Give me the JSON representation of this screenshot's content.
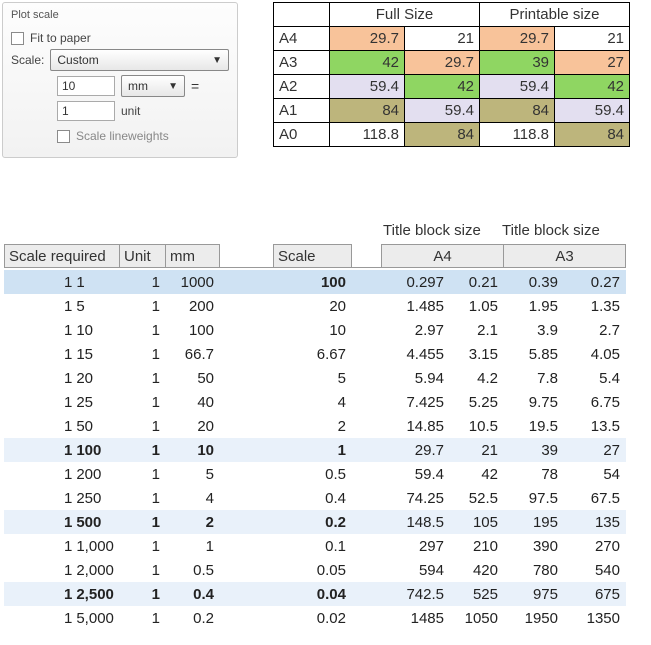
{
  "plot_scale": {
    "panel_title": "Plot scale",
    "fit_label": "Fit to paper",
    "scale_label": "Scale:",
    "scale_dropdown": "Custom",
    "value_a": "10",
    "unit_dropdown": "mm",
    "value_b": "1",
    "unit_text": "unit",
    "lineweights_label": "Scale lineweights"
  },
  "size_table": {
    "header_full": "Full Size",
    "header_print": "Printable size",
    "rows": [
      {
        "label": "A4",
        "full_a": "29.7",
        "full_b": "21",
        "print_a": "29.7",
        "print_b": "21",
        "cls_a": "c-orange",
        "cls_b": "c-white",
        "cls_c": "c-orange",
        "cls_d": "c-white"
      },
      {
        "label": "A3",
        "full_a": "42",
        "full_b": "29.7",
        "print_a": "39",
        "print_b": "27",
        "cls_a": "c-green",
        "cls_b": "c-orange",
        "cls_c": "c-green",
        "cls_d": "c-orange"
      },
      {
        "label": "A2",
        "full_a": "59.4",
        "full_b": "42",
        "print_a": "59.4",
        "print_b": "42",
        "cls_a": "c-lav",
        "cls_b": "c-green",
        "cls_c": "c-lav",
        "cls_d": "c-green"
      },
      {
        "label": "A1",
        "full_a": "84",
        "full_b": "59.4",
        "print_a": "84",
        "print_b": "59.4",
        "cls_a": "c-olive",
        "cls_b": "c-lav",
        "cls_c": "c-olive",
        "cls_d": "c-lav"
      },
      {
        "label": "A0",
        "full_a": "118.8",
        "full_b": "84",
        "print_a": "118.8",
        "print_b": "84",
        "cls_a": "c-white",
        "cls_b": "c-olive",
        "cls_c": "c-white",
        "cls_d": "c-olive"
      }
    ]
  },
  "scale_table": {
    "title_block_label": "Title block size",
    "headers": {
      "scale_required": "Scale required",
      "unit": "Unit",
      "mm": "mm",
      "scale": "Scale",
      "a4": "A4",
      "a3": "A3"
    },
    "rows": [
      {
        "hl": "blue",
        "bold": false,
        "sr": "1",
        "ratio": "1",
        "unit": "1",
        "mm": "1000",
        "scale": "100",
        "a4a": "0.297",
        "a4b": "0.21",
        "a3a": "0.39",
        "a3b": "0.27",
        "scale_bold": true
      },
      {
        "hl": "",
        "bold": false,
        "sr": "1",
        "ratio": "5",
        "unit": "1",
        "mm": "200",
        "scale": "20",
        "a4a": "1.485",
        "a4b": "1.05",
        "a3a": "1.95",
        "a3b": "1.35"
      },
      {
        "hl": "",
        "bold": false,
        "sr": "1",
        "ratio": "10",
        "unit": "1",
        "mm": "100",
        "scale": "10",
        "a4a": "2.97",
        "a4b": "2.1",
        "a3a": "3.9",
        "a3b": "2.7"
      },
      {
        "hl": "",
        "bold": false,
        "sr": "1",
        "ratio": "15",
        "unit": "1",
        "mm": "66.7",
        "scale": "6.67",
        "a4a": "4.455",
        "a4b": "3.15",
        "a3a": "5.85",
        "a3b": "4.05"
      },
      {
        "hl": "",
        "bold": false,
        "sr": "1",
        "ratio": "20",
        "unit": "1",
        "mm": "50",
        "scale": "5",
        "a4a": "5.94",
        "a4b": "4.2",
        "a3a": "7.8",
        "a3b": "5.4"
      },
      {
        "hl": "",
        "bold": false,
        "sr": "1",
        "ratio": "25",
        "unit": "1",
        "mm": "40",
        "scale": "4",
        "a4a": "7.425",
        "a4b": "5.25",
        "a3a": "9.75",
        "a3b": "6.75"
      },
      {
        "hl": "",
        "bold": false,
        "sr": "1",
        "ratio": "50",
        "unit": "1",
        "mm": "20",
        "scale": "2",
        "a4a": "14.85",
        "a4b": "10.5",
        "a3a": "19.5",
        "a3b": "13.5"
      },
      {
        "hl": "light",
        "bold": true,
        "sr": "1",
        "ratio": "100",
        "unit": "1",
        "mm": "10",
        "scale": "1",
        "a4a": "29.7",
        "a4b": "21",
        "a3a": "39",
        "a3b": "27"
      },
      {
        "hl": "",
        "bold": false,
        "sr": "1",
        "ratio": "200",
        "unit": "1",
        "mm": "5",
        "scale": "0.5",
        "a4a": "59.4",
        "a4b": "42",
        "a3a": "78",
        "a3b": "54"
      },
      {
        "hl": "",
        "bold": false,
        "sr": "1",
        "ratio": "250",
        "unit": "1",
        "mm": "4",
        "scale": "0.4",
        "a4a": "74.25",
        "a4b": "52.5",
        "a3a": "97.5",
        "a3b": "67.5"
      },
      {
        "hl": "light",
        "bold": true,
        "sr": "1",
        "ratio": "500",
        "unit": "1",
        "mm": "2",
        "scale": "0.2",
        "a4a": "148.5",
        "a4b": "105",
        "a3a": "195",
        "a3b": "135"
      },
      {
        "hl": "",
        "bold": false,
        "sr": "1",
        "ratio": "1,000",
        "unit": "1",
        "mm": "1",
        "scale": "0.1",
        "a4a": "297",
        "a4b": "210",
        "a3a": "390",
        "a3b": "270"
      },
      {
        "hl": "",
        "bold": false,
        "sr": "1",
        "ratio": "2,000",
        "unit": "1",
        "mm": "0.5",
        "scale": "0.05",
        "a4a": "594",
        "a4b": "420",
        "a3a": "780",
        "a3b": "540"
      },
      {
        "hl": "light",
        "bold": true,
        "sr": "1",
        "ratio": "2,500",
        "unit": "1",
        "mm": "0.4",
        "scale": "0.04",
        "a4a": "742.5",
        "a4b": "525",
        "a3a": "975",
        "a3b": "675"
      },
      {
        "hl": "",
        "bold": false,
        "sr": "1",
        "ratio": "5,000",
        "unit": "1",
        "mm": "0.2",
        "scale": "0.02",
        "a4a": "1485",
        "a4b": "1050",
        "a3a": "1950",
        "a3b": "1350"
      }
    ]
  }
}
